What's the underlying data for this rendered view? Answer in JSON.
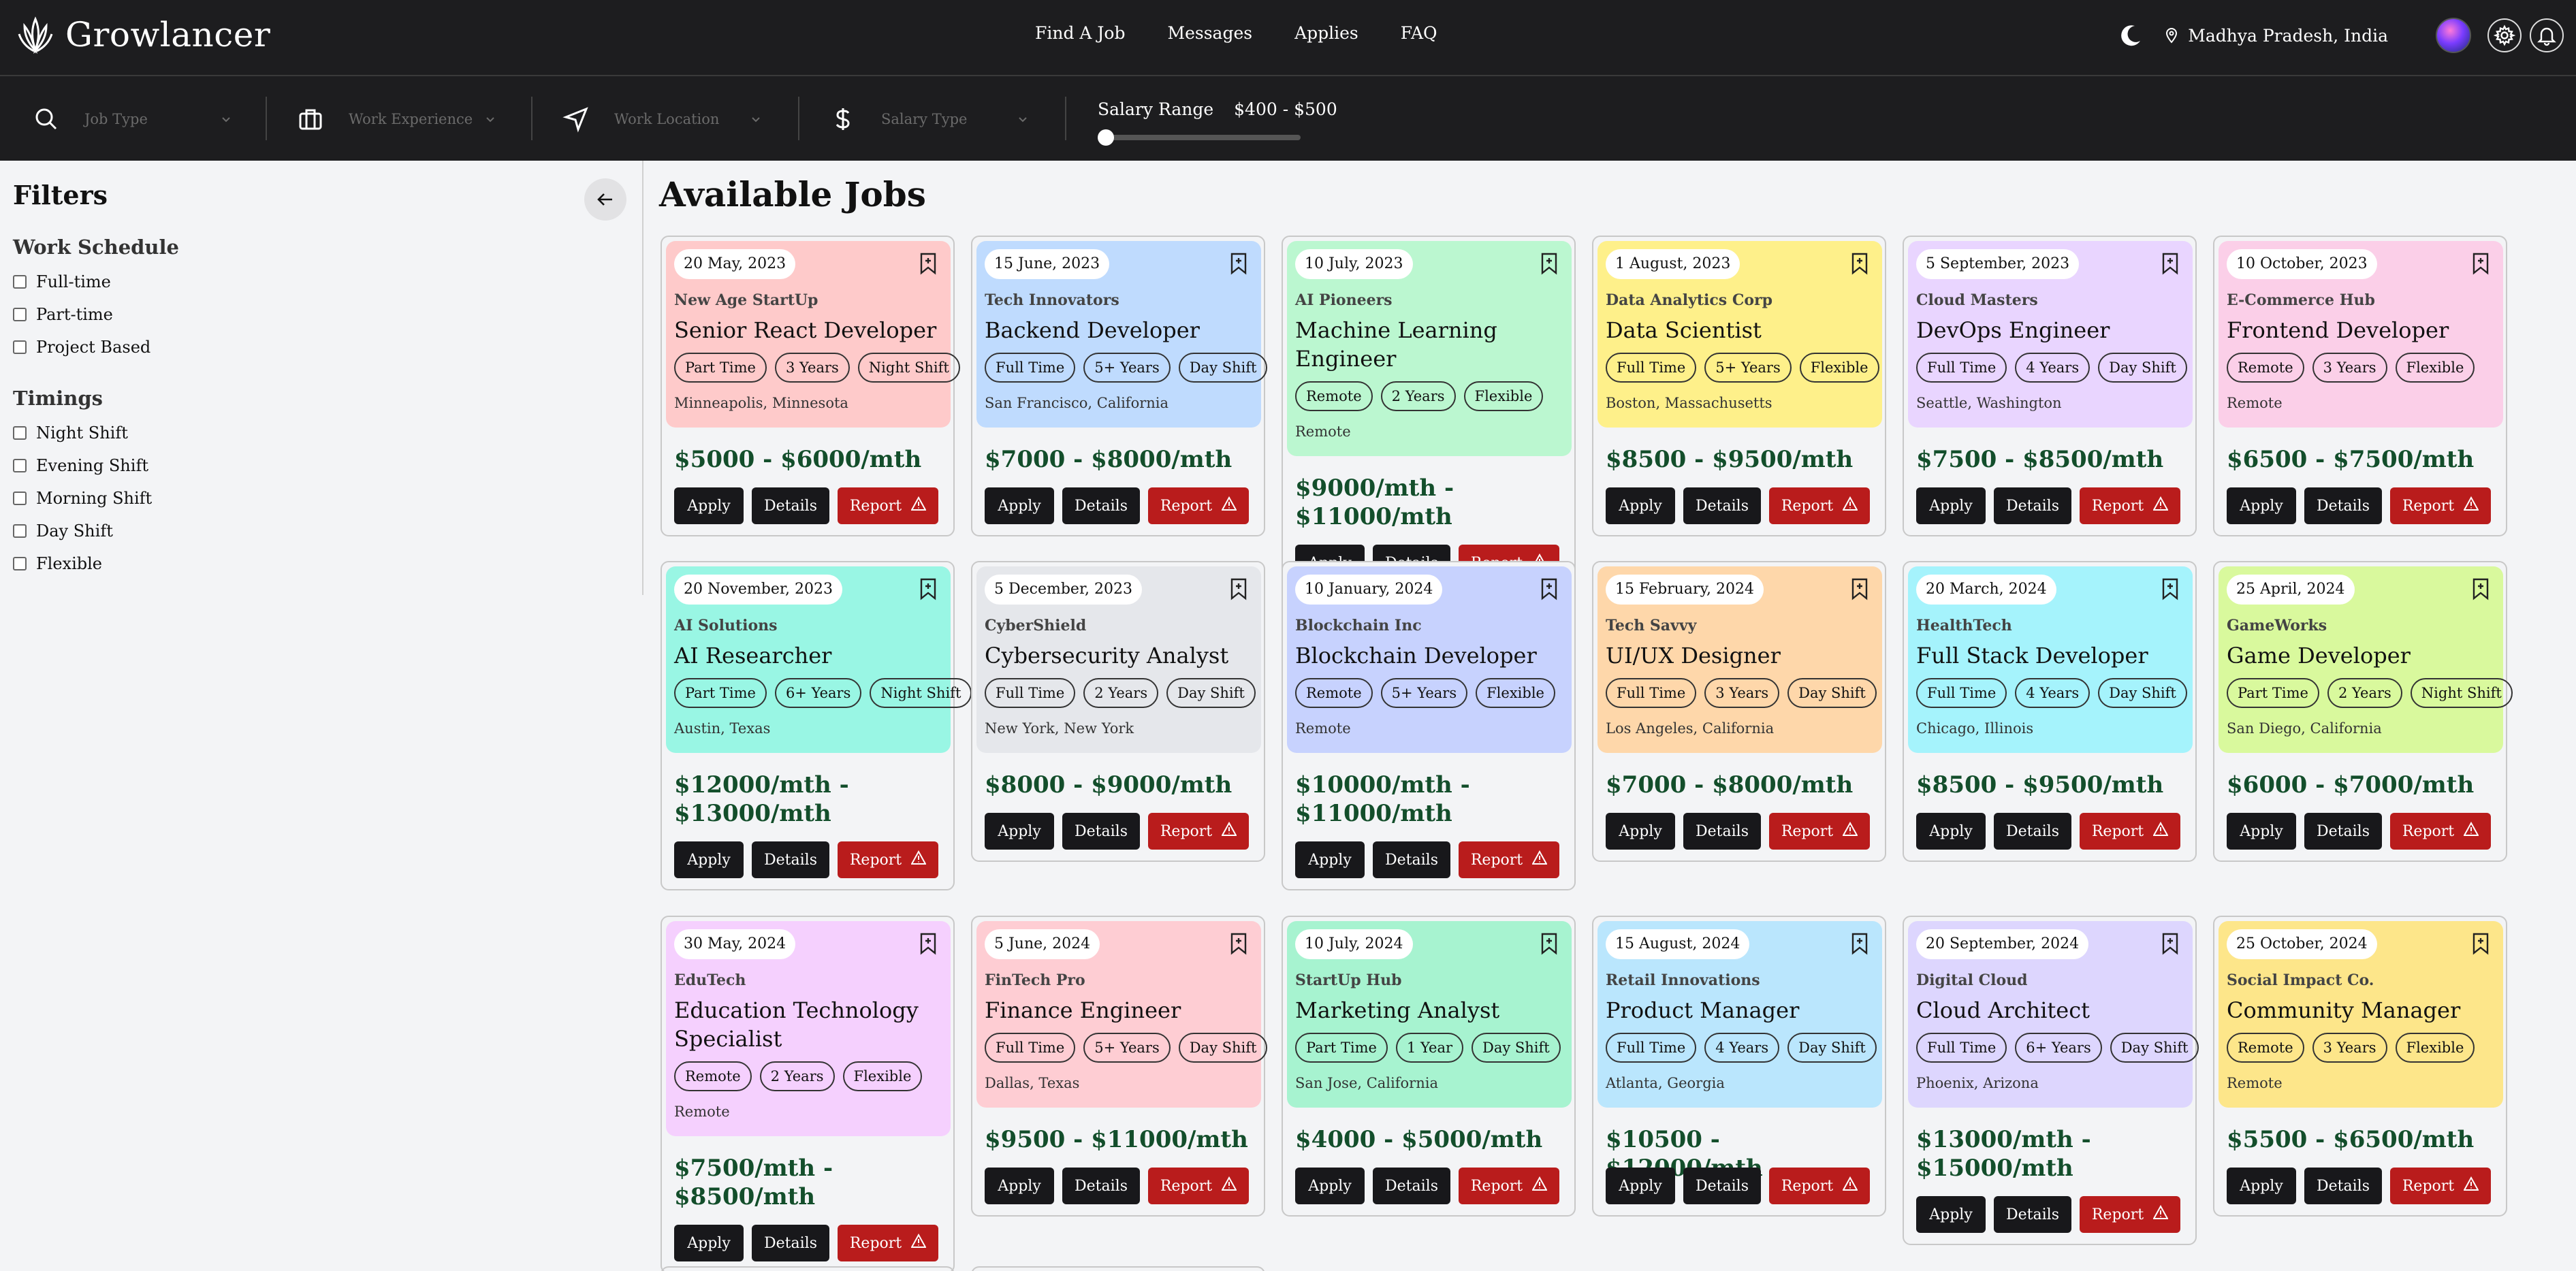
{
  "brand": {
    "name": "Growlancer"
  },
  "nav": [
    "Find A Job",
    "Messages",
    "Applies",
    "FAQ"
  ],
  "header": {
    "location": "Madhya Pradesh, India"
  },
  "search": {
    "job_type": "Job Type",
    "work_experience": "Work Experience",
    "work_location": "Work Location",
    "salary_type": "Salary Type",
    "salary_range_label": "Salary Range",
    "salary_range_value": "$400 - $500",
    "salary_range_fraction": 0
  },
  "filters": {
    "title": "Filters",
    "work_schedule": {
      "title": "Work Schedule",
      "items": [
        "Full-time",
        "Part-time",
        "Project Based"
      ]
    },
    "timings": {
      "title": "Timings",
      "items": [
        "Night Shift",
        "Evening Shift",
        "Morning Shift",
        "Day Shift",
        "Flexible"
      ]
    }
  },
  "main": {
    "title": "Available Jobs"
  },
  "buttons": {
    "apply": "Apply",
    "details": "Details",
    "report": "Report"
  },
  "jobs": [
    {
      "date": "20 May, 2023",
      "company": "New Age StartUp",
      "title": "Senior React Developer",
      "tags": [
        "Part Time",
        "3 Years",
        "Night Shift"
      ],
      "location": "Minneapolis, Minnesota",
      "salary": "$5000 - $6000/mth",
      "color": "#fecaca"
    },
    {
      "date": "15 June, 2023",
      "company": "Tech Innovators",
      "title": "Backend Developer",
      "tags": [
        "Full Time",
        "5+ Years",
        "Day Shift"
      ],
      "location": "San Francisco, California",
      "salary": "$7000 - $8000/mth",
      "color": "#bfdbfe"
    },
    {
      "date": "10 July, 2023",
      "company": "AI Pioneers",
      "title": "Machine Learning Engineer",
      "tags": [
        "Remote",
        "2 Years",
        "Flexible"
      ],
      "location": "Remote",
      "salary": "$9000/mth - $11000/mth",
      "color": "#bbf7d0"
    },
    {
      "date": "1 August, 2023",
      "company": "Data Analytics Corp",
      "title": "Data Scientist",
      "tags": [
        "Full Time",
        "5+ Years",
        "Flexible"
      ],
      "location": "Boston, Massachusetts",
      "salary": "$8500 - $9500/mth",
      "color": "#fef08a"
    },
    {
      "date": "5 September, 2023",
      "company": "Cloud Masters",
      "title": "DevOps Engineer",
      "tags": [
        "Full Time",
        "4 Years",
        "Day Shift"
      ],
      "location": "Seattle, Washington",
      "salary": "$7500 - $8500/mth",
      "color": "#e9d5ff"
    },
    {
      "date": "10 October, 2023",
      "company": "E-Commerce Hub",
      "title": "Frontend Developer",
      "tags": [
        "Remote",
        "3 Years",
        "Flexible"
      ],
      "location": "Remote",
      "salary": "$6500 - $7500/mth",
      "color": "#fbcfe8"
    },
    {
      "date": "20 November, 2023",
      "company": "AI Solutions",
      "title": "AI Researcher",
      "tags": [
        "Part Time",
        "6+ Years",
        "Night Shift"
      ],
      "location": "Austin, Texas",
      "salary": "$12000/mth - $13000/mth",
      "color": "#99f6e4"
    },
    {
      "date": "5 December, 2023",
      "company": "CyberShield",
      "title": "Cybersecurity Analyst",
      "tags": [
        "Full Time",
        "2 Years",
        "Day Shift"
      ],
      "location": "New York, New York",
      "salary": "$8000 - $9000/mth",
      "color": "#e5e7eb"
    },
    {
      "date": "10 January, 2024",
      "company": "Blockchain Inc",
      "title": "Blockchain Developer",
      "tags": [
        "Remote",
        "5+ Years",
        "Flexible"
      ],
      "location": "Remote",
      "salary": "$10000/mth - $11000/mth",
      "color": "#c7d2fe"
    },
    {
      "date": "15 February, 2024",
      "company": "Tech Savvy",
      "title": "UI/UX Designer",
      "tags": [
        "Full Time",
        "3 Years",
        "Day Shift"
      ],
      "location": "Los Angeles, California",
      "salary": "$7000 - $8000/mth",
      "color": "#fed7aa"
    },
    {
      "date": "20 March, 2024",
      "company": "HealthTech",
      "title": "Full Stack Developer",
      "tags": [
        "Full Time",
        "4 Years",
        "Day Shift"
      ],
      "location": "Chicago, Illinois",
      "salary": "$8500 - $9500/mth",
      "color": "#a5f3fc"
    },
    {
      "date": "25 April, 2024",
      "company": "GameWorks",
      "title": "Game Developer",
      "tags": [
        "Part Time",
        "2 Years",
        "Night Shift"
      ],
      "location": "San Diego, California",
      "salary": "$6000 - $7000/mth",
      "color": "#d9f99d"
    },
    {
      "date": "30 May, 2024",
      "company": "EduTech",
      "title": "Education Technology Specialist",
      "tags": [
        "Remote",
        "2 Years",
        "Flexible"
      ],
      "location": "Remote",
      "salary": "$7500/mth - $8500/mth",
      "color": "#f5d0fe"
    },
    {
      "date": "5 June, 2024",
      "company": "FinTech Pro",
      "title": "Finance Engineer",
      "tags": [
        "Full Time",
        "5+ Years",
        "Day Shift"
      ],
      "location": "Dallas, Texas",
      "salary": "$9500 - $11000/mth",
      "color": "#fecdd3"
    },
    {
      "date": "10 July, 2024",
      "company": "StartUp Hub",
      "title": "Marketing Analyst",
      "tags": [
        "Part Time",
        "1 Year",
        "Day Shift"
      ],
      "location": "San Jose, California",
      "salary": "$4000 - $5000/mth",
      "color": "#a7f3d0"
    },
    {
      "date": "15 August, 2024",
      "company": "Retail Innovations",
      "title": "Product Manager",
      "tags": [
        "Full Time",
        "4 Years",
        "Day Shift"
      ],
      "location": "Atlanta, Georgia",
      "salary": "$10500 - $12000/mth",
      "color": "#bae6fd"
    },
    {
      "date": "20 September, 2024",
      "company": "Digital Cloud",
      "title": "Cloud Architect",
      "tags": [
        "Full Time",
        "6+ Years",
        "Day Shift"
      ],
      "location": "Phoenix, Arizona",
      "salary": "$13000/mth - $15000/mth",
      "color": "#ddd6fe"
    },
    {
      "date": "25 October, 2024",
      "company": "Social Impact Co.",
      "title": "Community Manager",
      "tags": [
        "Remote",
        "3 Years",
        "Flexible"
      ],
      "location": "Remote",
      "salary": "$5500 - $6500/mth",
      "color": "#fde68a"
    }
  ]
}
